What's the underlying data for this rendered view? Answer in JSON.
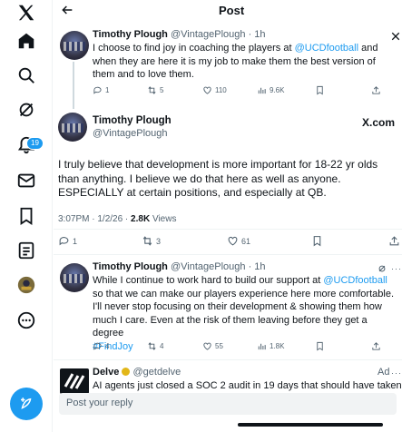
{
  "header": {
    "title": "Post"
  },
  "nav": {
    "icons": [
      "x-logo-icon",
      "home-icon",
      "search-icon",
      "grok-icon",
      "notifications-icon",
      "messages-icon",
      "bookmarks-icon",
      "lists-icon",
      "profile-avatar",
      "more-icon"
    ],
    "notif_count": "19"
  },
  "tweet1": {
    "name": "Timothy Plough",
    "handle": "@VintagePlough",
    "time": "· 1h",
    "text_a": "I choose to find joy in coaching the players at ",
    "link": "@UCDfootball",
    "text_b": " and when they are here it is my job to make them the best version of them and to love them.",
    "replies": "1",
    "reposts": "5",
    "likes": "110",
    "views": "9.6K"
  },
  "main_tweet": {
    "name": "Timothy Plough",
    "handle": "@VintagePlough",
    "source": "X.com",
    "text": "I truly believe that development is more important for 18-22 yr olds than anything.  I believe we do that here as well as anyone. ESPECIALLY at certain positions, and especially at QB.",
    "meta_time": "3:07PM · 1/2/26 · ",
    "views_count": "2.8K",
    "views_label": " Views",
    "replies": "1",
    "reposts": "3",
    "likes": "61"
  },
  "tweet3": {
    "name": "Timothy Plough",
    "handle": "@VintagePlough",
    "time": "· 1h",
    "text_a": "While I continue to work hard to build our support at ",
    "link": "@UCDfootball",
    "text_b": " so that we can make our players experience here more comfortable. I'll never stop focusing on their development & showing them how much I care. Even at the risk of them leaving before they get a degree",
    "hashtag": "#FindJoy",
    "replies": "4",
    "reposts": "4",
    "likes": "55",
    "views": "1.8K"
  },
  "ad": {
    "name": "Delve",
    "handle": "@getdelve",
    "label": "Ad",
    "text": "AI agents just closed a SOC 2 audit in 19 days that should have taken"
  },
  "reply_bar": {
    "placeholder": "Post your reply"
  },
  "colors": {
    "accent": "#1d9bf0",
    "text": "#0f1419",
    "muted": "#536471"
  }
}
